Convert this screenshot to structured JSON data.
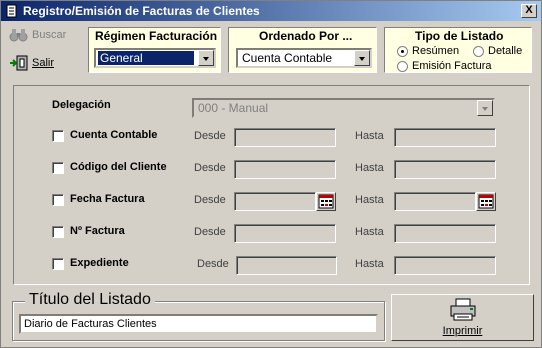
{
  "window": {
    "title": "Registro/Emisión de Facturas de Clientes",
    "close_label": "X"
  },
  "toolbar": {
    "search_label": "Buscar",
    "exit_label": "Salir"
  },
  "regimen": {
    "title": "Régimen Facturación",
    "value": "General"
  },
  "ordenado": {
    "title": "Ordenado Por ...",
    "value": "Cuenta Contable"
  },
  "tipo": {
    "title": "Tipo de Listado",
    "options": [
      {
        "label": "Resúmen",
        "selected": true
      },
      {
        "label": "Detalle",
        "selected": false
      },
      {
        "label": "Emisión Factura",
        "selected": false
      }
    ]
  },
  "filters": {
    "delegacion_label": "Delegación",
    "delegacion_value": "000 - Manual",
    "desde_label": "Desde",
    "hasta_label": "Hasta",
    "rows": [
      {
        "label": "Cuenta Contable",
        "checked": false
      },
      {
        "label": "Código del Cliente",
        "checked": false
      },
      {
        "label": "Fecha Factura",
        "checked": false
      },
      {
        "label": "Nº Factura",
        "checked": false
      },
      {
        "label": "Expediente",
        "checked": false
      }
    ]
  },
  "listado": {
    "title": "Título del Listado",
    "value": "Diario de Facturas Clientes"
  },
  "print": {
    "label": "Imprimir"
  }
}
